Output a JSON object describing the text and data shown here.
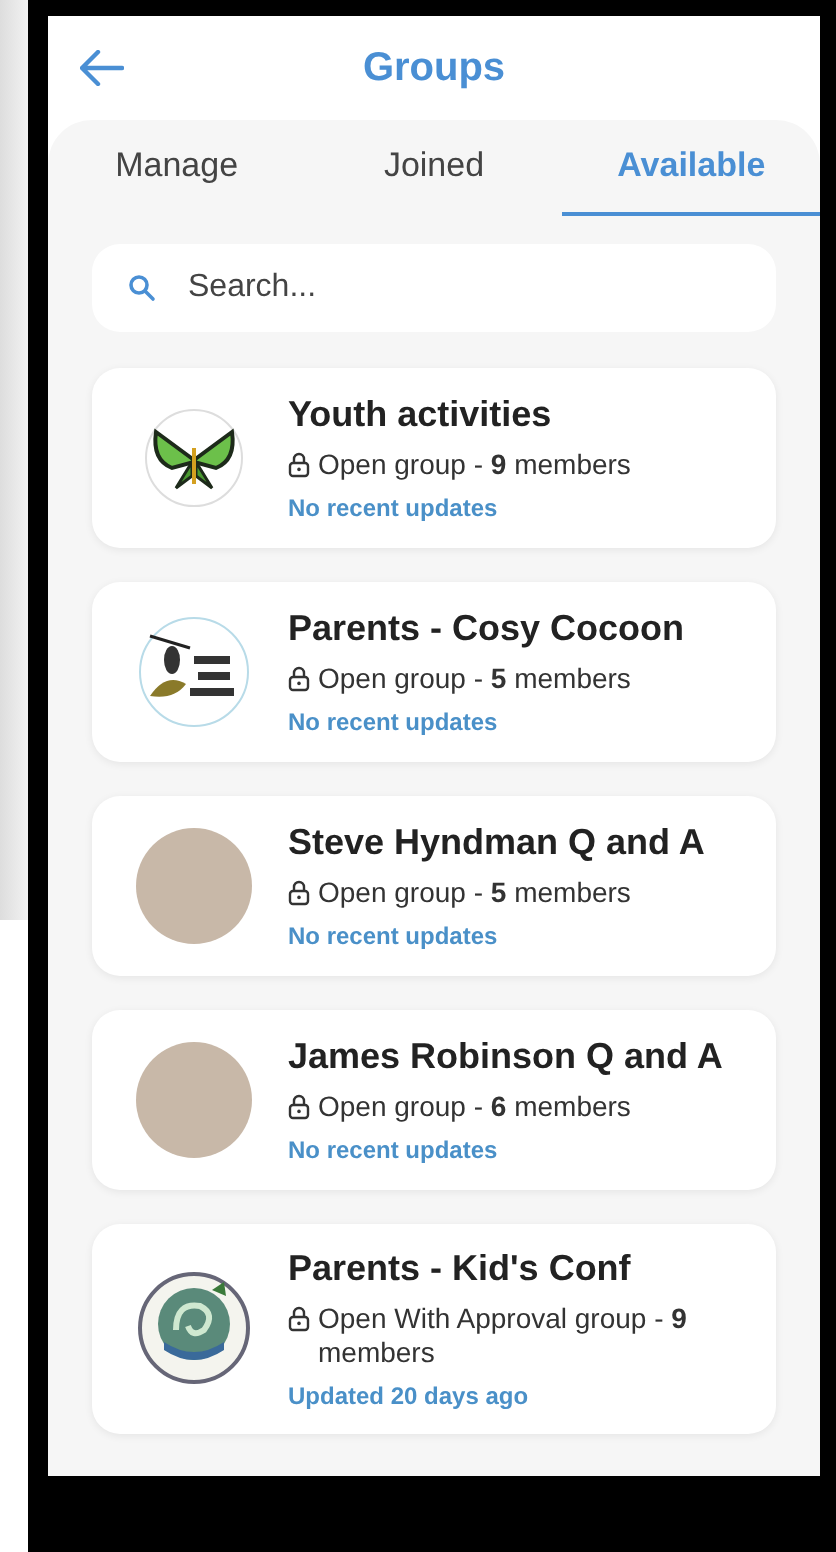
{
  "header": {
    "title": "Groups"
  },
  "tabs": [
    {
      "label": "Manage",
      "selected": false
    },
    {
      "label": "Joined",
      "selected": false
    },
    {
      "label": "Available",
      "selected": true
    }
  ],
  "search": {
    "placeholder": "Search..."
  },
  "groups": [
    {
      "name": "Youth activities",
      "kind": "butterfly-logo",
      "info": "Open group - **9** members",
      "updates": "No recent updates"
    },
    {
      "name": "Parents - Cosy Cocoon",
      "kind": "cocoon-logo",
      "info": "Open group - **5** members",
      "updates": "No recent updates"
    },
    {
      "name": "Steve Hyndman Q and A",
      "kind": "photo",
      "info": "Open group - **5** members",
      "updates": "No recent updates"
    },
    {
      "name": "James Robinson Q and A",
      "kind": "photo",
      "info": "Open group - **6** members",
      "updates": "No recent updates"
    },
    {
      "name": "Parents - Kid's Conf",
      "kind": "round-logo",
      "info": "Open With Approval group - **9** members",
      "updates": "Updated 20 days ago"
    }
  ]
}
